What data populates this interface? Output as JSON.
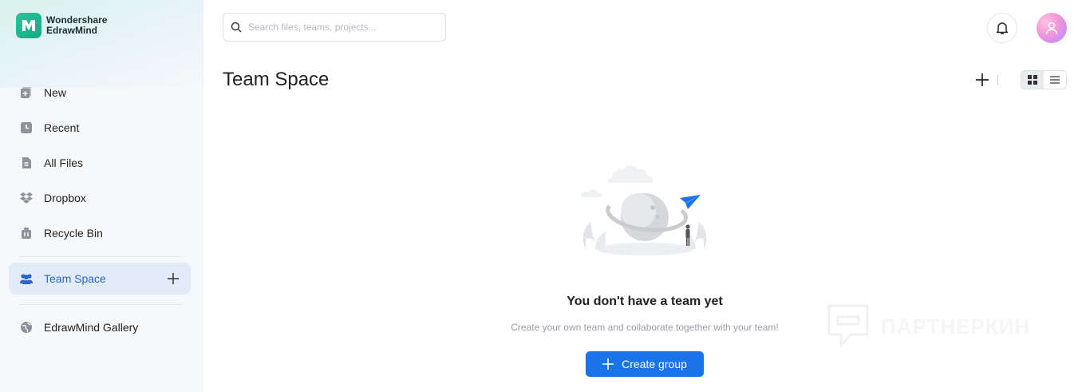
{
  "brand": {
    "line1": "Wondershare",
    "line2": "EdrawMind"
  },
  "sidebar": {
    "items": [
      {
        "label": "New",
        "icon": "new-file-icon"
      },
      {
        "label": "Recent",
        "icon": "clock-icon"
      },
      {
        "label": "All Files",
        "icon": "document-icon"
      },
      {
        "label": "Dropbox",
        "icon": "dropbox-icon"
      },
      {
        "label": "Recycle Bin",
        "icon": "trash-icon"
      },
      {
        "label": "Team Space",
        "icon": "team-icon",
        "active": true
      },
      {
        "label": "EdrawMind Gallery",
        "icon": "globe-icon"
      }
    ]
  },
  "search": {
    "placeholder": "Search files, teams, projects...",
    "value": ""
  },
  "main": {
    "title": "Team Space",
    "empty_title": "You don't have a team yet",
    "empty_subtitle": "Create your own team and collaborate together with your team!",
    "create_label": "Create group"
  },
  "watermark": {
    "text": "ПАРТНЕРКИН"
  },
  "colors": {
    "accent": "#1a73e8",
    "active_bg": "#e2ebf8",
    "active_text": "#2a66c6",
    "brand_green": "#1fb68e"
  }
}
